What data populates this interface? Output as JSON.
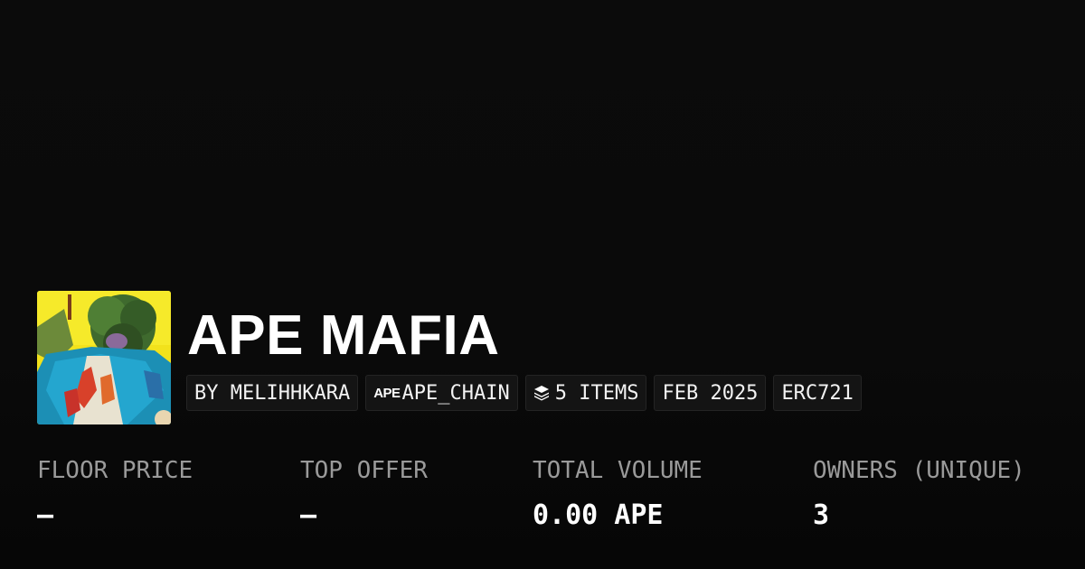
{
  "collection": {
    "title": "APE MAFIA",
    "thumbnail_icon": "collection-avatar-image"
  },
  "tags": {
    "creator": "BY MELIHHKARA",
    "chain_logo": "APE",
    "chain": "APE_CHAIN",
    "items": "5 ITEMS",
    "date": "FEB 2025",
    "standard": "ERC721"
  },
  "stats": {
    "floor_price": {
      "label": "FLOOR PRICE",
      "value": "—"
    },
    "top_offer": {
      "label": "TOP OFFER",
      "value": "—"
    },
    "total_volume": {
      "label": "TOTAL VOLUME",
      "value": "0.00 APE"
    },
    "owners": {
      "label": "OWNERS (UNIQUE)",
      "value": "3"
    }
  },
  "colors": {
    "background": "#0b0b0b",
    "label_gray": "#9a9a9a",
    "tag_bg": "#141414",
    "tag_border": "#242424"
  }
}
